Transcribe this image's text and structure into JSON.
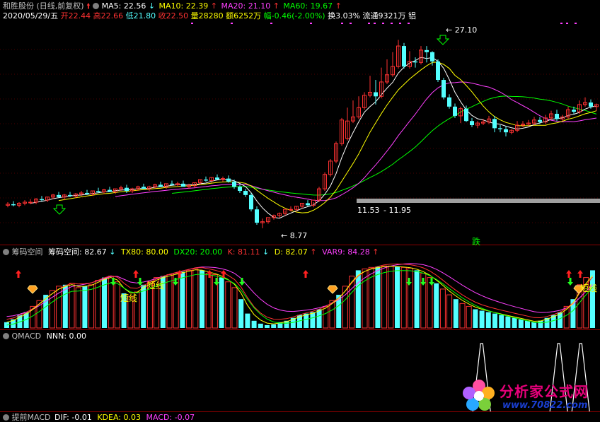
{
  "header": {
    "stock_name": "和胜股份",
    "period": "(日线,前复权)",
    "ma5": "MA5: 22.56",
    "ma10": "MA10: 22.39",
    "ma20": "MA20: 21.10",
    "ma60": "MA60: 19.67",
    "date": "2020/05/29/五",
    "open": "开22.44",
    "high": "高22.66",
    "low": "低21.80",
    "close": "收22.50",
    "volume": "量28280",
    "amount": "额6252万",
    "change": "幅-0.46(-2.00%)",
    "turnover": "换3.03%",
    "float": "流通9321万",
    "industry": "铝"
  },
  "panel2": {
    "name": "筹码空间",
    "value": "筹码空间: 82.67",
    "tx80": "TX80: 80.00",
    "dx20": "DX20: 20.00",
    "k": "K: 81.11",
    "d": "D: 82.07",
    "var9": "VAR9: 84.28",
    "label_short": "短线"
  },
  "panel3": {
    "name": "QMACD",
    "nnn": "NNN: 0.00"
  },
  "panel4": {
    "name": "提前MACD",
    "dif": "DIF: -0.01",
    "kdea": "KDEA: 0.03",
    "macd": "MACD: -0.07"
  },
  "logo": {
    "title": "分析家公式网",
    "url": "www.70822.com"
  },
  "colors": {
    "up": "#ff3232",
    "down": "#54ffff",
    "ma5": "#ffffff",
    "ma10": "#ffff00",
    "ma20": "#ff40ff",
    "ma60": "#00ff00",
    "header_date": "#ffffff"
  },
  "chart_data": [
    {
      "type": "candlestick",
      "title": "和胜股份 (日线,前复权)",
      "series": [
        {
          "name": "MA5",
          "value": 22.56
        },
        {
          "name": "MA10",
          "value": 22.39
        },
        {
          "name": "MA20",
          "value": 21.1
        },
        {
          "name": "MA60",
          "value": 19.67
        }
      ],
      "annotations": [
        {
          "text": "27.10",
          "kind": "high"
        },
        {
          "text": "11.53",
          "kind": "level"
        },
        {
          "text": "11.95",
          "kind": "level"
        },
        {
          "text": "8.77",
          "kind": "low"
        },
        {
          "text": "跌",
          "kind": "signal"
        }
      ],
      "ylim": [
        8,
        28.5
      ],
      "x": [
        1,
        2,
        3,
        4,
        5,
        6,
        7,
        8,
        9,
        10,
        11,
        12,
        13,
        14,
        15,
        16,
        17,
        18,
        19,
        20,
        21,
        22,
        23,
        24,
        25,
        26,
        27,
        28,
        29,
        30,
        31,
        32,
        33,
        34,
        35,
        36,
        37,
        38,
        39,
        40,
        41,
        42,
        43,
        44,
        45,
        46,
        47,
        48,
        49,
        50,
        51,
        52,
        53,
        54,
        55,
        56,
        57,
        58,
        59,
        60,
        61,
        62,
        63,
        64,
        65,
        66,
        67,
        68,
        69,
        70,
        71,
        72,
        73,
        74,
        75,
        76,
        77,
        78,
        79,
        80,
        81,
        82,
        83,
        84,
        85,
        86,
        87,
        88,
        89,
        90,
        91,
        92,
        93,
        94,
        95,
        96,
        97,
        98,
        99,
        100,
        101,
        102,
        103,
        104,
        105
      ],
      "open": [
        11.0,
        11.1,
        11.0,
        11.2,
        11.3,
        11.3,
        11.6,
        11.5,
        11.8,
        12.0,
        11.8,
        12.0,
        11.9,
        12.1,
        12.2,
        12.1,
        12.4,
        12.3,
        12.5,
        12.3,
        12.6,
        12.7,
        12.4,
        12.6,
        12.8,
        12.6,
        12.8,
        13.0,
        12.8,
        13.1,
        13.0,
        13.1,
        12.8,
        12.9,
        13.2,
        13.5,
        13.4,
        13.7,
        13.5,
        13.6,
        13.3,
        12.8,
        12.4,
        12.0,
        10.6,
        9.3,
        9.4,
        9.8,
        10.0,
        10.2,
        10.6,
        10.6,
        10.9,
        11.2,
        11.0,
        11.5,
        12.6,
        14.0,
        15.3,
        17.0,
        17.5,
        19.2,
        19.6,
        20.5,
        21.7,
        22.0,
        21.6,
        23.0,
        23.7,
        24.5,
        26.5,
        24.5,
        25.0,
        24.9,
        26.1,
        25.9,
        25.0,
        23.2,
        21.5,
        20.6,
        19.7,
        20.4,
        19.2,
        18.8,
        19.0,
        19.1,
        19.4,
        18.5,
        18.4,
        18.1,
        18.3,
        18.8,
        18.9,
        19.0,
        19.3,
        19.1,
        19.5,
        19.9,
        19.4,
        19.6,
        20.3,
        20.1,
        20.8,
        21.0,
        20.6
      ],
      "high": [
        11.3,
        11.4,
        11.3,
        11.5,
        11.6,
        11.7,
        11.9,
        11.8,
        12.1,
        12.3,
        12.1,
        12.3,
        12.2,
        12.4,
        12.5,
        12.4,
        12.7,
        12.6,
        12.8,
        12.6,
        12.9,
        13.0,
        12.7,
        12.9,
        13.1,
        12.9,
        13.1,
        13.3,
        13.1,
        13.4,
        13.3,
        13.4,
        13.1,
        13.2,
        13.5,
        13.8,
        13.7,
        14.0,
        13.8,
        13.9,
        13.5,
        13.0,
        12.6,
        12.2,
        10.9,
        9.7,
        9.7,
        10.1,
        10.3,
        10.5,
        10.9,
        10.9,
        11.2,
        11.5,
        11.3,
        12.8,
        14.2,
        15.5,
        17.2,
        19.5,
        20.5,
        21.2,
        21.6,
        22.0,
        23.6,
        23.2,
        24.4,
        25.2,
        25.9,
        27.1,
        26.8,
        26.0,
        25.4,
        26.5,
        26.5,
        26.0,
        25.2,
        23.4,
        21.8,
        20.9,
        20.6,
        20.7,
        19.5,
        19.2,
        19.4,
        19.7,
        19.7,
        18.8,
        18.7,
        18.4,
        19.2,
        19.2,
        19.3,
        19.6,
        19.6,
        19.8,
        20.2,
        20.3,
        19.8,
        20.6,
        20.6,
        21.2,
        21.5,
        21.3,
        20.9
      ],
      "low": [
        10.8,
        10.9,
        10.8,
        11.0,
        11.1,
        11.1,
        11.4,
        11.3,
        11.6,
        11.7,
        11.5,
        11.8,
        11.7,
        11.9,
        12.0,
        11.9,
        12.2,
        12.1,
        12.3,
        12.1,
        12.4,
        12.2,
        12.2,
        12.4,
        12.6,
        12.4,
        12.6,
        12.8,
        12.6,
        12.9,
        12.8,
        12.9,
        12.6,
        12.7,
        13.0,
        13.3,
        13.2,
        13.5,
        13.3,
        13.2,
        12.6,
        12.2,
        11.8,
        10.4,
        9.1,
        8.77,
        9.2,
        9.6,
        9.8,
        10.0,
        10.4,
        10.4,
        10.7,
        10.9,
        10.8,
        11.3,
        12.4,
        13.8,
        15.1,
        16.8,
        17.3,
        19.0,
        19.4,
        20.3,
        21.5,
        20.8,
        21.4,
        22.8,
        23.5,
        24.3,
        24.3,
        24.3,
        24.4,
        24.7,
        24.9,
        24.6,
        23.0,
        21.3,
        20.4,
        19.5,
        19.0,
        19.1,
        18.6,
        18.5,
        18.8,
        18.9,
        18.1,
        18.1,
        17.7,
        17.9,
        18.1,
        18.6,
        18.7,
        18.8,
        18.9,
        18.9,
        19.3,
        19.2,
        19.2,
        19.4,
        19.9,
        19.9,
        20.6,
        20.4,
        20.2
      ],
      "close": [
        11.1,
        11.0,
        11.2,
        11.3,
        11.3,
        11.6,
        11.5,
        11.8,
        12.0,
        11.8,
        12.0,
        11.9,
        12.1,
        12.2,
        12.1,
        12.4,
        12.3,
        12.5,
        12.3,
        12.6,
        12.7,
        12.4,
        12.6,
        12.8,
        12.6,
        12.8,
        13.0,
        12.8,
        13.1,
        13.0,
        13.1,
        12.8,
        12.9,
        13.2,
        13.5,
        13.4,
        13.7,
        13.5,
        13.6,
        13.3,
        12.8,
        12.4,
        12.0,
        10.6,
        9.3,
        9.4,
        9.8,
        10.0,
        10.2,
        10.6,
        10.6,
        10.9,
        11.2,
        11.0,
        11.5,
        12.6,
        14.0,
        15.3,
        17.0,
        19.3,
        19.2,
        19.6,
        20.5,
        21.7,
        22.0,
        21.6,
        23.0,
        23.7,
        24.5,
        26.5,
        24.5,
        25.0,
        24.9,
        26.1,
        25.9,
        25.0,
        23.2,
        21.5,
        20.6,
        19.7,
        20.4,
        19.2,
        18.8,
        19.0,
        19.1,
        19.4,
        18.5,
        18.4,
        18.1,
        18.3,
        18.8,
        18.9,
        19.0,
        19.3,
        19.1,
        19.5,
        19.9,
        19.4,
        19.6,
        20.3,
        20.1,
        20.8,
        21.0,
        20.6,
        20.8
      ]
    },
    {
      "type": "bar",
      "title": "筹码空间",
      "series": [
        {
          "name": "筹码空间",
          "value": 82.67
        },
        {
          "name": "TX80",
          "value": 80.0
        },
        {
          "name": "DX20",
          "value": 20.0
        },
        {
          "name": "K",
          "value": 81.11
        },
        {
          "name": "D",
          "value": 82.07
        },
        {
          "name": "VAR9",
          "value": 84.28
        }
      ],
      "ylim": [
        0,
        100
      ],
      "values": [
        8,
        12,
        18,
        22,
        30,
        38,
        46,
        52,
        58,
        60,
        62,
        56,
        58,
        60,
        66,
        70,
        72,
        64,
        48,
        44,
        50,
        60,
        64,
        70,
        72,
        74,
        76,
        78,
        80,
        82,
        80,
        76,
        74,
        70,
        64,
        56,
        40,
        20,
        10,
        6,
        4,
        5,
        8,
        10,
        14,
        18,
        20,
        22,
        26,
        30,
        38,
        46,
        58,
        72,
        80,
        82,
        84,
        85,
        86,
        86,
        85,
        84,
        83,
        80,
        76,
        70,
        62,
        54,
        46,
        40,
        34,
        30,
        26,
        24,
        22,
        20,
        18,
        16,
        14,
        12,
        10,
        8,
        10,
        14,
        18,
        22,
        30,
        40,
        60,
        70,
        80
      ]
    },
    {
      "type": "line",
      "title": "QMACD",
      "series": [
        {
          "name": "NNN",
          "value": 0.0
        }
      ],
      "ylim": [
        0,
        1
      ],
      "values": [
        0,
        0,
        0,
        0,
        0,
        0,
        0,
        0,
        0,
        0,
        0,
        0,
        0,
        0,
        0,
        0,
        0,
        0,
        0,
        0,
        0,
        0,
        0,
        0,
        0,
        0,
        0,
        0,
        0,
        0,
        0,
        0,
        0,
        0,
        0,
        0,
        0,
        0,
        0,
        0,
        0,
        0,
        0,
        0,
        0,
        0,
        0,
        0,
        0,
        0,
        0,
        0,
        0,
        0,
        0,
        0,
        0,
        0,
        0,
        0,
        0,
        0,
        0,
        0,
        0,
        0,
        0,
        0,
        0,
        0,
        0,
        0,
        0,
        0,
        0,
        0,
        0,
        0,
        0,
        0,
        0,
        0,
        0,
        0,
        0,
        0,
        0,
        1,
        0,
        0,
        0,
        0,
        0,
        0,
        0,
        0,
        0,
        0,
        0,
        0,
        0,
        1,
        0,
        0,
        0,
        1,
        0,
        0,
        0
      ]
    },
    {
      "type": "line",
      "title": "提前MACD",
      "series": [
        {
          "name": "DIF",
          "value": -0.01
        },
        {
          "name": "KDEA",
          "value": 0.03
        },
        {
          "name": "MACD",
          "value": -0.07
        }
      ]
    }
  ]
}
